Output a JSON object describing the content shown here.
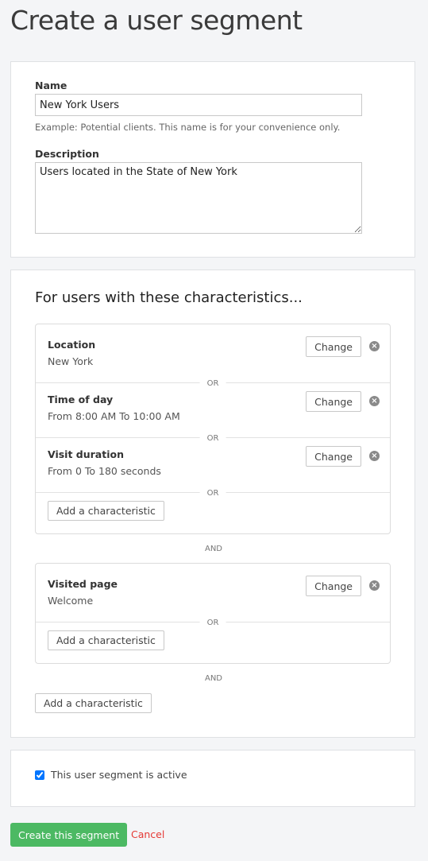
{
  "page_title": "Create a user segment",
  "form": {
    "name_label": "Name",
    "name_value": "New York Users",
    "name_hint": "Example: Potential clients. This name is for your convenience only.",
    "description_label": "Description",
    "description_value": "Users located in the State of New York"
  },
  "characteristics": {
    "heading": "For users with these characteristics...",
    "groups": [
      {
        "items": [
          {
            "title": "Location",
            "value": "New York"
          },
          {
            "title": "Time of day",
            "value": "From 8:00 AM To 10:00 AM"
          },
          {
            "title": "Visit duration",
            "value": "From 0 To 180 seconds"
          }
        ]
      },
      {
        "items": [
          {
            "title": "Visited page",
            "value": "Welcome"
          }
        ]
      }
    ],
    "change_label": "Change",
    "or_label": "OR",
    "and_label": "AND",
    "add_label": "Add a characteristic",
    "remove_icon": "circle-x-icon"
  },
  "active": {
    "label": "This user segment is active",
    "checked": true
  },
  "actions": {
    "create_label": "Create this segment",
    "cancel_label": "Cancel",
    "create_color": "#4cb963",
    "cancel_color": "#e53935"
  }
}
